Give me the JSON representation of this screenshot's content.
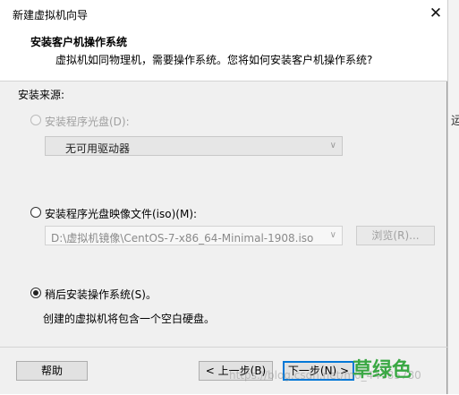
{
  "window": {
    "title": "新建虚拟机向导",
    "close_glyph": "✕"
  },
  "header": {
    "title": "安装客户机操作系统",
    "description": "虚拟机如同物理机，需要操作系统。您将如何安装客户机操作系统?"
  },
  "install_source": {
    "label": "安装来源:",
    "options": [
      {
        "label": "安装程序光盘(D):",
        "selected": false,
        "enabled": false,
        "combo_value": "无可用驱动器"
      },
      {
        "label": "安装程序光盘映像文件(iso)(M):",
        "selected": false,
        "enabled": true,
        "path_value": "D:\\虚拟机镜像\\CentOS-7-x86_64-Minimal-1908.iso",
        "browse_label": "浏览(R)..."
      },
      {
        "label": "稍后安装操作系统(S)。",
        "selected": true,
        "enabled": true,
        "hint": "创建的虚拟机将包含一个空白硬盘。"
      }
    ]
  },
  "footer": {
    "help_label": "帮助",
    "back_label": "< 上一步(B)",
    "next_label": "下一步(N) >",
    "overlay_text": "草绿色",
    "watermark": "https://blog.csdn.net/m0_44785780"
  },
  "background": {
    "partial_glyph": "运"
  },
  "colors": {
    "accent": "#0078d7",
    "overlay": "#3aa844"
  },
  "icons": {
    "combo_chevron": "chevron-down-icon",
    "close": "close-icon"
  }
}
